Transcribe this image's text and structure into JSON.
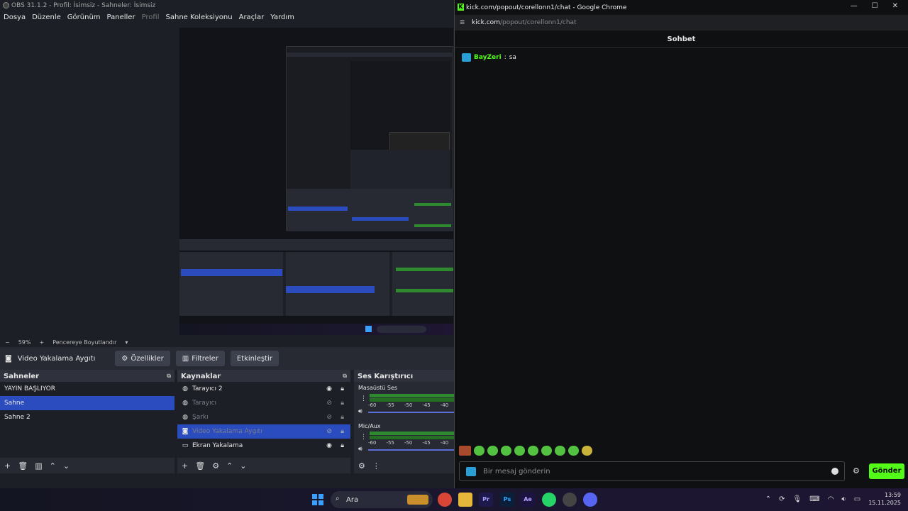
{
  "obs": {
    "title": "OBS 31.1.2 - Profil: İsimsiz - Sahneler: İsimsiz",
    "menu": [
      "Dosya",
      "Düzenle",
      "Görünüm",
      "Paneller",
      "Profil",
      "Sahne Koleksiyonu",
      "Araçlar",
      "Yardım"
    ],
    "zoom": "59%",
    "zoom_mode": "Pencereye Boyutlandır",
    "context_source": "Video Yakalama Aygıtı",
    "context_buttons": [
      "Özellikler",
      "Filtreler",
      "Etkinleştir"
    ],
    "scenes_title": "Sahneler",
    "scenes": [
      "YAYIN BAŞLIYOR",
      "Sahne",
      "Sahne 2"
    ],
    "selected_scene_index": 1,
    "sources_title": "Kaynaklar",
    "sources": [
      {
        "name": "Tarayıcı 2",
        "icon": "globe-icon",
        "visible": true
      },
      {
        "name": "Tarayıcı",
        "icon": "globe-icon",
        "visible": false
      },
      {
        "name": "Şarkı",
        "icon": "globe-icon",
        "visible": false
      },
      {
        "name": "Video Yakalama Aygıtı",
        "icon": "camera-icon",
        "visible": false
      },
      {
        "name": "Ekran Yakalama",
        "icon": "monitor-icon",
        "visible": true
      }
    ],
    "selected_source_index": 3,
    "mixer_title": "Ses Karıştırıcı",
    "mixer_channels": [
      "Masaüstü Ses",
      "Mic/Aux"
    ],
    "mixer_ticks": [
      "-60",
      "-55",
      "-50",
      "-45",
      "-40"
    ]
  },
  "chrome": {
    "title": "kick.com/popout/corellonn1/chat - Google Chrome",
    "url_host": "kick.com",
    "url_path": "/popout/corellonn1/chat",
    "chat_header": "Sohbet",
    "messages": [
      {
        "user": "BayZeri",
        "text": "sa"
      }
    ],
    "input_placeholder": "Bir mesaj gönderin",
    "send_label": "Gönder",
    "accent": "#53fc18"
  },
  "taskbar": {
    "search_label": "Ara",
    "time": "13:59",
    "date": "15.11.2025",
    "apps": [
      "Pr",
      "Ps",
      "Ae"
    ]
  }
}
